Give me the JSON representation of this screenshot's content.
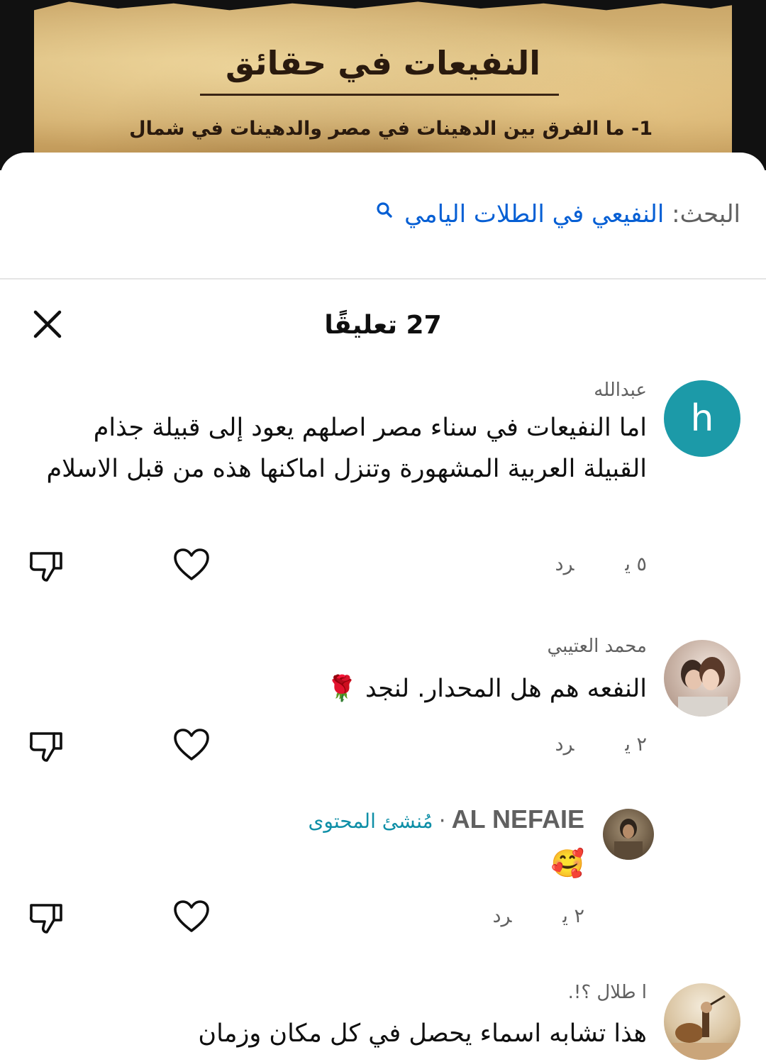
{
  "banner": {
    "title": "النفيعات في حقائق",
    "subtitle": "1- ما الفرق بين الدهينات في مصر والدهينات في شمال"
  },
  "search": {
    "prefix": "البحث:",
    "query": "النفيعي في الطلات اليامي",
    "icon": "search-icon"
  },
  "header": {
    "title": "27 تعليقًا",
    "close_icon": "close-icon"
  },
  "comments": [
    {
      "author": "عبدالله",
      "avatar_letter": "h",
      "avatar_color": "#1c9aa8",
      "text": "اما النفيعات في سناء مصر اصلهم يعود إلى قبيلة جذام القبيلة العربية المشهورة وتنزل اماكنها هذه من قبل الاسلام",
      "time": "٥ ي",
      "reply_label": "رد"
    },
    {
      "author": "محمد العتيبي",
      "text": "النفعه هم هل المحدار. لنجد 🌹",
      "time": "٢ ي",
      "reply_label": "رد"
    },
    {
      "author": "AL NEFAIE",
      "separator": "·",
      "creator_badge": "مُنشئ المحتوى",
      "text": "🥰",
      "time": "٢ ي",
      "reply_label": "رد"
    },
    {
      "author": "ا طلال ؟!.",
      "text": "هذا تشابه اسماء يحصل في كل مكان وزمان"
    }
  ],
  "colors": {
    "accent_link": "#065fd4",
    "creator_badge": "#0f8fa7",
    "secondary_text": "#606060"
  }
}
